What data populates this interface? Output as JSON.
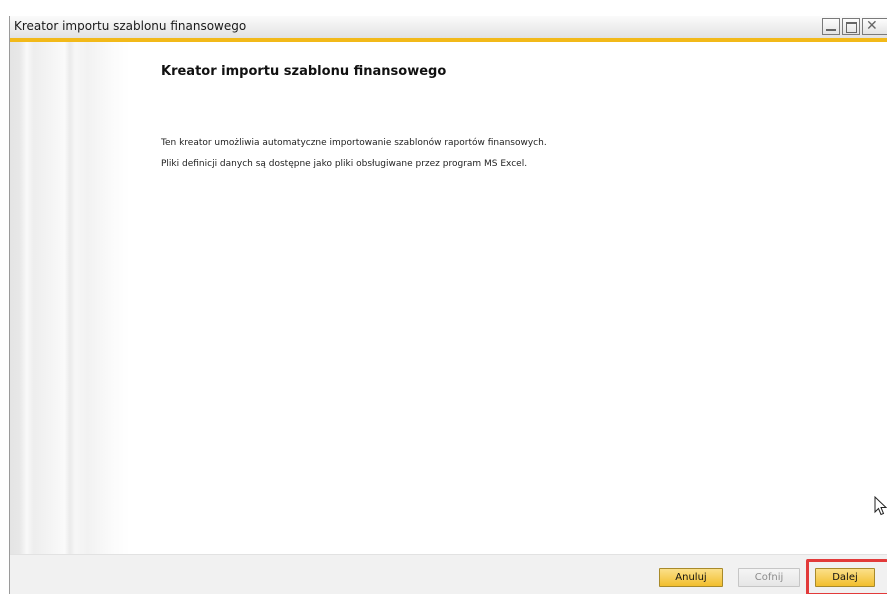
{
  "window": {
    "title": "Kreator importu szablonu finansowego"
  },
  "main": {
    "heading": "Kreator importu szablonu finansowego",
    "description_lines": [
      "Ten kreator umożliwia automatyczne importowanie szablonów raportów finansowych.",
      "Pliki definicji danych są dostępne jako pliki obsługiwane przez program MS Excel."
    ]
  },
  "footer": {
    "cancel_label": "Anuluj",
    "back_label": "Cofnij",
    "next_label": "Dalej",
    "back_enabled": false
  },
  "colors": {
    "accent": "#f2b919",
    "primary_button": "#f2be2d",
    "highlight": "#e23a3a"
  },
  "icons": {
    "minimize": "minimize-icon",
    "maximize": "maximize-icon",
    "close": "close-icon",
    "cursor": "mouse-pointer-icon"
  }
}
